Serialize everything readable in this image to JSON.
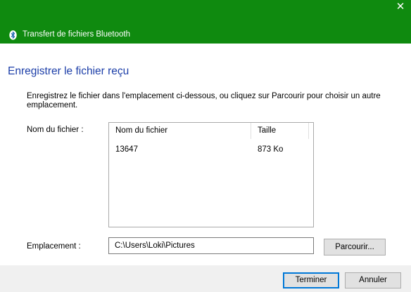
{
  "window": {
    "title": "Transfert de fichiers Bluetooth",
    "title_icon": "bluetooth-icon",
    "close_glyph": "✕",
    "accent_color": "#0f8a0f"
  },
  "main": {
    "heading": "Enregistrer le fichier reçu",
    "instructions": "Enregistrez le fichier dans l'emplacement ci-dessous, ou cliquez sur Parcourir pour choisir un autre emplacement.",
    "filename_label": "Nom du fichier :",
    "file_table": {
      "columns": [
        "Nom du fichier",
        "Taille"
      ],
      "rows": [
        {
          "name": "13647",
          "size": "873 Ko"
        }
      ]
    },
    "location_label": "Emplacement :",
    "location_value": "C:\\Users\\Loki\\Pictures",
    "browse_label": "Parcourir..."
  },
  "footer": {
    "finish_label": "Terminer",
    "cancel_label": "Annuler"
  }
}
